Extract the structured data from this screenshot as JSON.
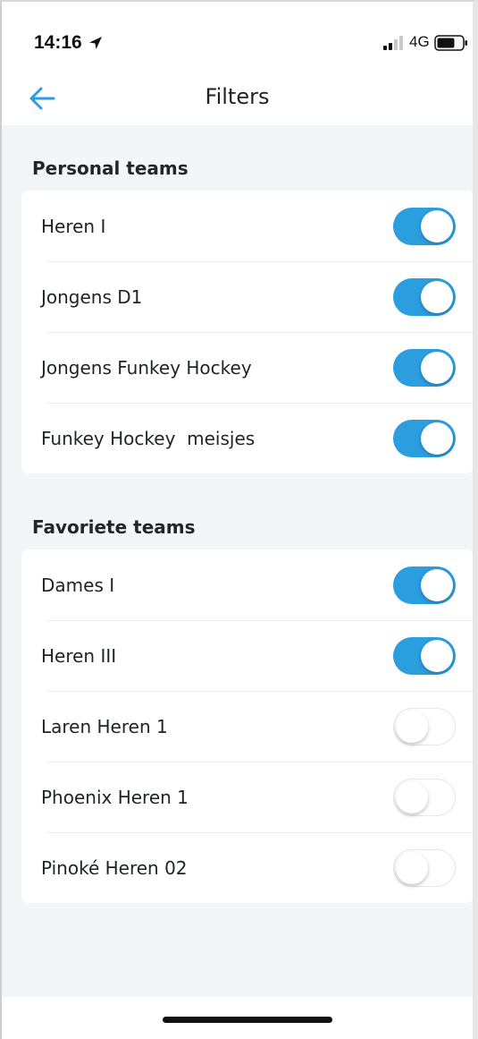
{
  "status_bar": {
    "time": "14:16",
    "network": "4G",
    "icons": [
      "location-arrow-icon",
      "signal-icon",
      "battery-icon"
    ]
  },
  "header": {
    "title": "Filters",
    "back_icon": "arrow-left-icon"
  },
  "colors": {
    "accent": "#2b9ee0",
    "background": "#f3f6f9",
    "card": "#ffffff"
  },
  "personal": {
    "title": "Personal teams",
    "items": [
      {
        "label": "Heren I",
        "enabled": true
      },
      {
        "label": "Jongens D1",
        "enabled": true
      },
      {
        "label": "Jongens Funkey Hockey",
        "enabled": true
      },
      {
        "label": "Funkey Hockey  meisjes",
        "enabled": true
      }
    ]
  },
  "favorites": {
    "title": "Favoriete teams",
    "items": [
      {
        "label": "Dames I",
        "enabled": true
      },
      {
        "label": "Heren III",
        "enabled": true
      },
      {
        "label": "Laren Heren 1",
        "enabled": false
      },
      {
        "label": "Phoenix Heren 1",
        "enabled": false
      },
      {
        "label": "Pinoké Heren 02",
        "enabled": false
      }
    ]
  }
}
